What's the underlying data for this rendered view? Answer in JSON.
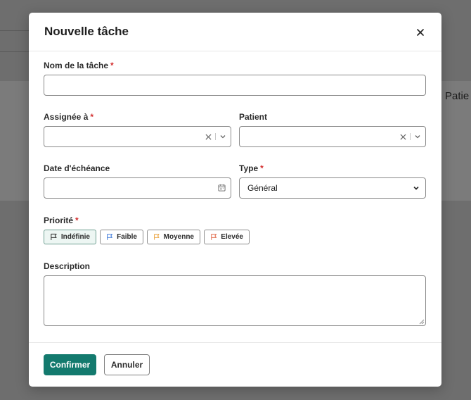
{
  "background": {
    "partial_heading": "Patie"
  },
  "modal": {
    "title": "Nouvelle tâche",
    "task_name": {
      "label": "Nom de la tâche",
      "required_mark": "*",
      "value": ""
    },
    "assigned_to": {
      "label": "Assignée à",
      "required_mark": "*",
      "value": ""
    },
    "patient": {
      "label": "Patient",
      "value": ""
    },
    "due_date": {
      "label": "Date d'échéance",
      "value": ""
    },
    "type": {
      "label": "Type",
      "required_mark": "*",
      "value": "Général"
    },
    "priority": {
      "label": "Priorité",
      "required_mark": "*",
      "options": [
        "Indéfinie",
        "Faible",
        "Moyenne",
        "Elevée"
      ],
      "selected": "Indéfinie",
      "flag_colors": [
        "#2a2a2a",
        "#2f6fd6",
        "#e89a2c",
        "#e06a4a"
      ]
    },
    "description": {
      "label": "Description",
      "value": ""
    },
    "confirm_label": "Confirmer",
    "cancel_label": "Annuler"
  },
  "colors": {
    "primary": "#137a6e",
    "required": "#d32f2f"
  }
}
